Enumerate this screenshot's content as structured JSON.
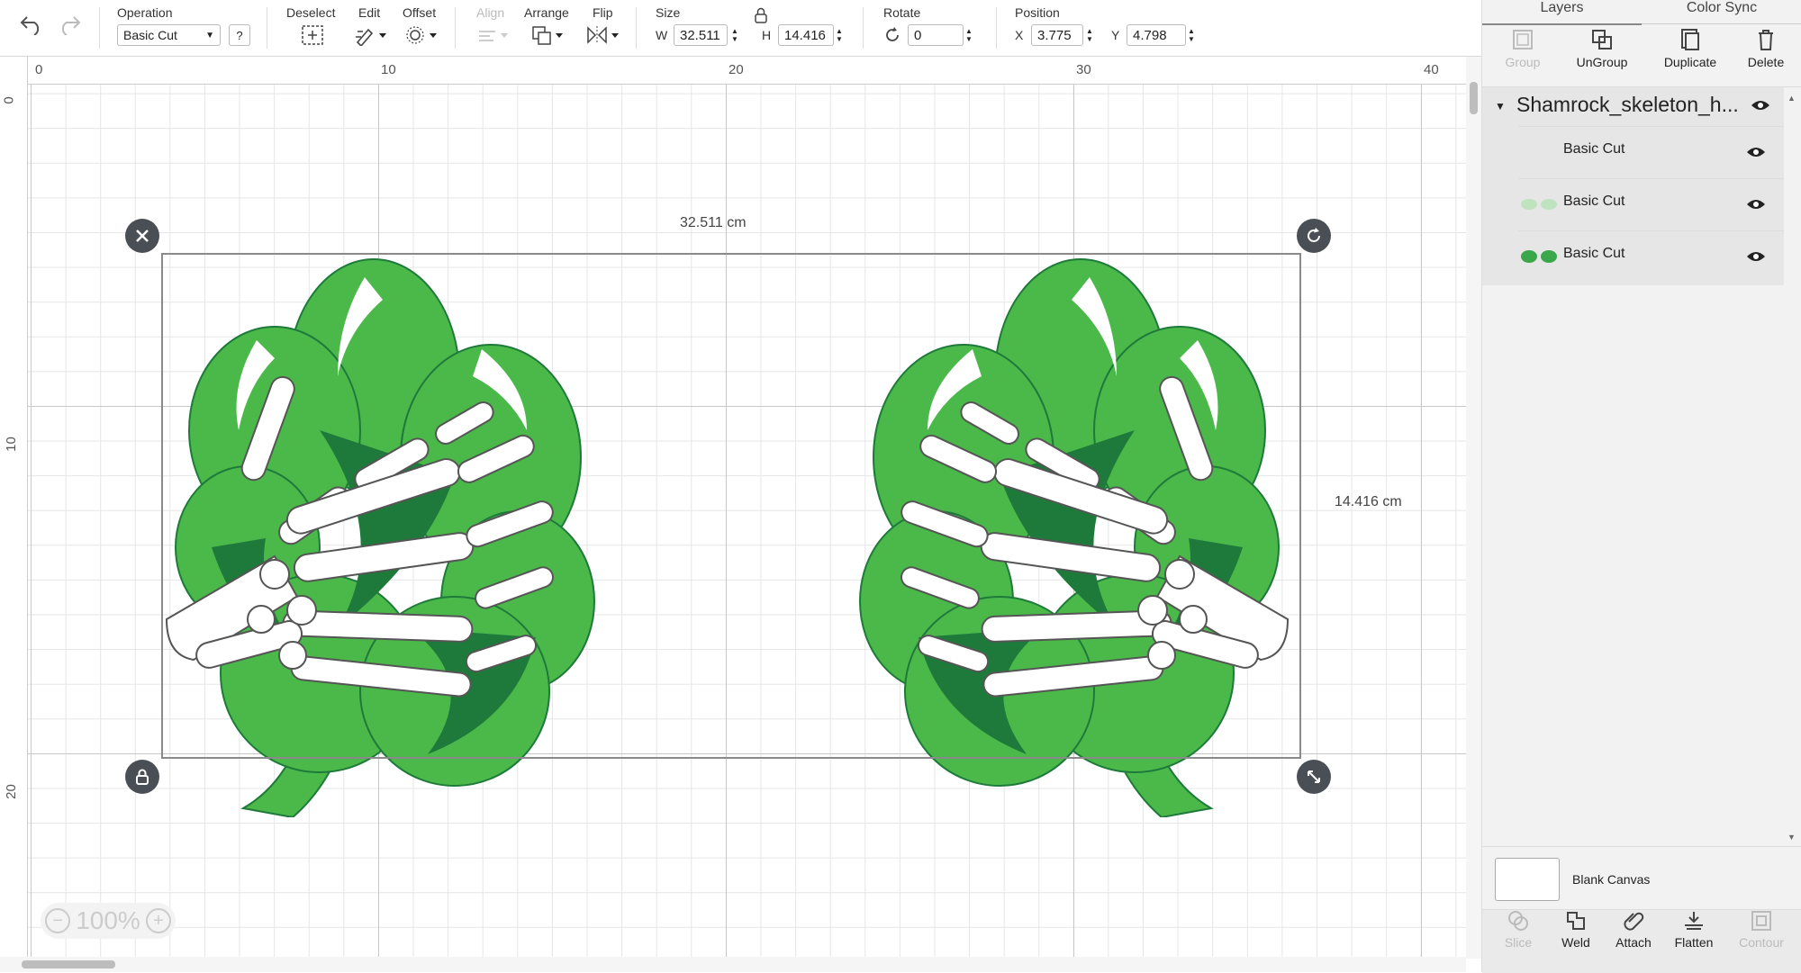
{
  "toolbar": {
    "operation_label": "Operation",
    "operation_value": "Basic Cut",
    "help_label": "?",
    "deselect_label": "Deselect",
    "edit_label": "Edit",
    "offset_label": "Offset",
    "align_label": "Align",
    "arrange_label": "Arrange",
    "flip_label": "Flip",
    "size_label": "Size",
    "w_label": "W",
    "w_value": "32.511",
    "h_label": "H",
    "h_value": "14.416",
    "rotate_label": "Rotate",
    "rotate_value": "0",
    "position_label": "Position",
    "x_label": "X",
    "x_value": "3.775",
    "y_label": "Y",
    "y_value": "4.798"
  },
  "rulers": {
    "h_ticks": [
      "0",
      "10",
      "20",
      "30",
      "40"
    ],
    "v_ticks": [
      "0",
      "10",
      "20"
    ]
  },
  "canvas": {
    "width_dim": "32.511 cm",
    "height_dim": "14.416 cm",
    "zoom": "100%"
  },
  "panel": {
    "tab_layers": "Layers",
    "tab_color_sync": "Color Sync",
    "group_label": "Group",
    "ungroup_label": "UnGroup",
    "duplicate_label": "Duplicate",
    "delete_label": "Delete",
    "group_name": "Shamrock_skeleton_h...",
    "layers": [
      {
        "name": "Basic Cut"
      },
      {
        "name": "Basic Cut"
      },
      {
        "name": "Basic Cut"
      }
    ],
    "blank_canvas": "Blank Canvas",
    "slice_label": "Slice",
    "weld_label": "Weld",
    "attach_label": "Attach",
    "flatten_label": "Flatten",
    "contour_label": "Contour"
  },
  "colors": {
    "shamrock_light": "#4bb84a",
    "shamrock_dark": "#1e7a3a",
    "bone": "#ffffff",
    "handle": "#4a4f55"
  }
}
